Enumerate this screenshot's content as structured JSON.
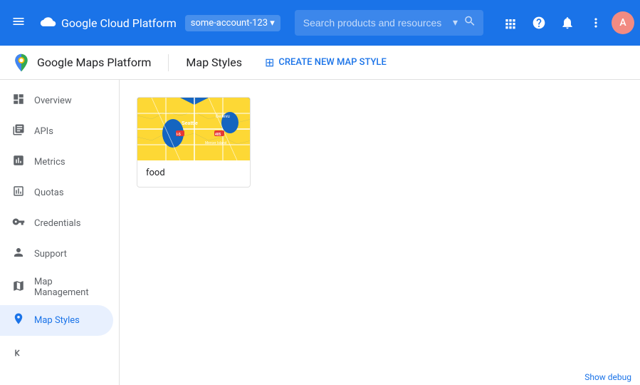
{
  "topbar": {
    "menu_icon": "☰",
    "title": "Google Cloud Platform",
    "account": "some-account-123",
    "search_placeholder": "Search products and resources",
    "icons": {
      "grid": "⊞",
      "help": "?",
      "bell": "🔔",
      "more": "⋮"
    },
    "avatar_text": "A"
  },
  "subheader": {
    "maps_title": "Google Maps Platform",
    "page_title": "Map Styles",
    "create_btn_label": "CREATE NEW MAP STYLE",
    "create_icon": "+"
  },
  "sidebar": {
    "items": [
      {
        "id": "overview",
        "label": "Overview",
        "icon": "⊙"
      },
      {
        "id": "apis",
        "label": "APIs",
        "icon": "☰"
      },
      {
        "id": "metrics",
        "label": "Metrics",
        "icon": "📊"
      },
      {
        "id": "quotas",
        "label": "Quotas",
        "icon": "□"
      },
      {
        "id": "credentials",
        "label": "Credentials",
        "icon": "🔑"
      },
      {
        "id": "support",
        "label": "Support",
        "icon": "👤"
      },
      {
        "id": "map-management",
        "label": "Map Management",
        "icon": "■"
      },
      {
        "id": "map-styles",
        "label": "Map Styles",
        "icon": "⊕",
        "active": true
      }
    ],
    "collapse_icon": "«"
  },
  "main": {
    "map_styles": [
      {
        "id": "food",
        "label": "food"
      }
    ]
  },
  "debug_bar": {
    "label": "Show debug"
  },
  "colors": {
    "primary": "#1a73e8",
    "topbar_bg": "#1a73e8",
    "active_item_bg": "#e8f0fe",
    "active_item_color": "#1a73e8",
    "map_water": "#1a73e8",
    "map_land": "#f5e642",
    "map_road": "#ffffff"
  }
}
